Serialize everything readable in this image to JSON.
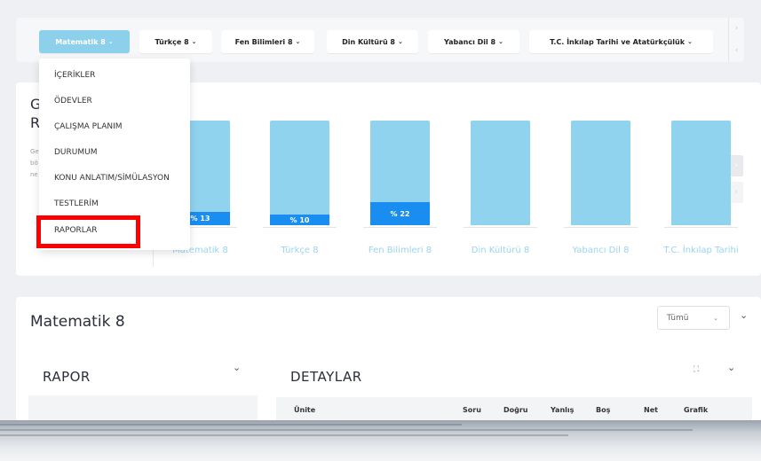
{
  "tabs": [
    {
      "label": "Matematik 8",
      "active": true
    },
    {
      "label": "Türkçe 8",
      "active": false
    },
    {
      "label": "Fen Bilimleri 8",
      "active": false
    },
    {
      "label": "Din Kültürü 8",
      "active": false
    },
    {
      "label": "Yabancı Dil 8",
      "active": false
    },
    {
      "label": "T.C. İnkılap Tarihi ve Atatürkçülük",
      "active": false
    }
  ],
  "overview": {
    "title_line1": "G",
    "title_line2": "R",
    "desc_line1": "Ge",
    "desc_line2": "bö",
    "desc_line3": "ne"
  },
  "chart_data": {
    "type": "bar",
    "categories": [
      "Matematik 8",
      "Türkçe 8",
      "Fen Bilimleri 8",
      "Din Kültürü 8",
      "Yabancı Dil 8",
      "T.C. İnkılap Tarihi"
    ],
    "values": [
      13,
      10,
      22,
      0,
      0,
      0
    ],
    "value_labels": [
      "% 13",
      "% 10",
      "% 22",
      "",
      "",
      ""
    ],
    "ylim": [
      0,
      100
    ],
    "colors": {
      "track": "#8fd3ee",
      "fill": "#1a8df0"
    }
  },
  "dropdown": {
    "items": [
      "İÇERİKLER",
      "ÖDEVLER",
      "ÇALIŞMA PLANIM",
      "DURUMUM",
      "KONU ANLATIM/SİMÜLASYON",
      "TESTLERİM",
      "RAPORLAR"
    ],
    "highlighted": "RAPORLAR"
  },
  "subject": {
    "title": "Matematik 8",
    "filter_value": "Tümü"
  },
  "rapor": {
    "title": "RAPOR"
  },
  "detaylar": {
    "title": "DETAYLAR",
    "columns": [
      "Ünite",
      "Soru",
      "Doğru",
      "Yanlış",
      "Boş",
      "Net",
      "Grafik"
    ]
  },
  "icons": {
    "chevron": "chevron-down-icon",
    "expand": "expand-icon"
  }
}
